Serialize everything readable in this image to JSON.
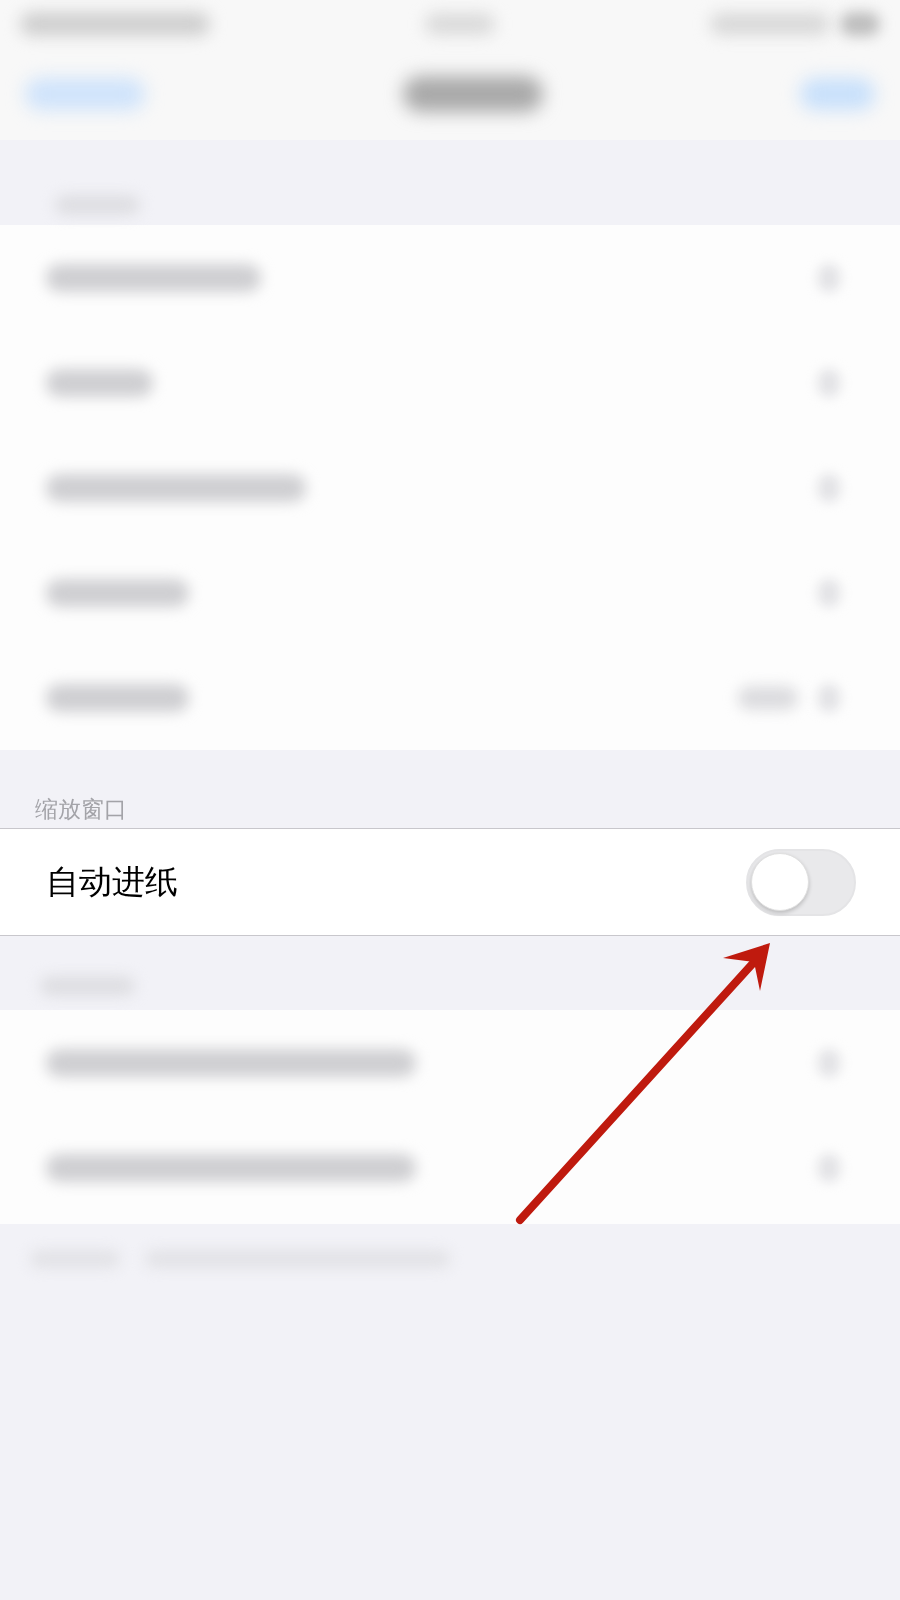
{
  "section_header": "缩放窗口",
  "setting": {
    "label": "自动进纸",
    "on": false
  }
}
